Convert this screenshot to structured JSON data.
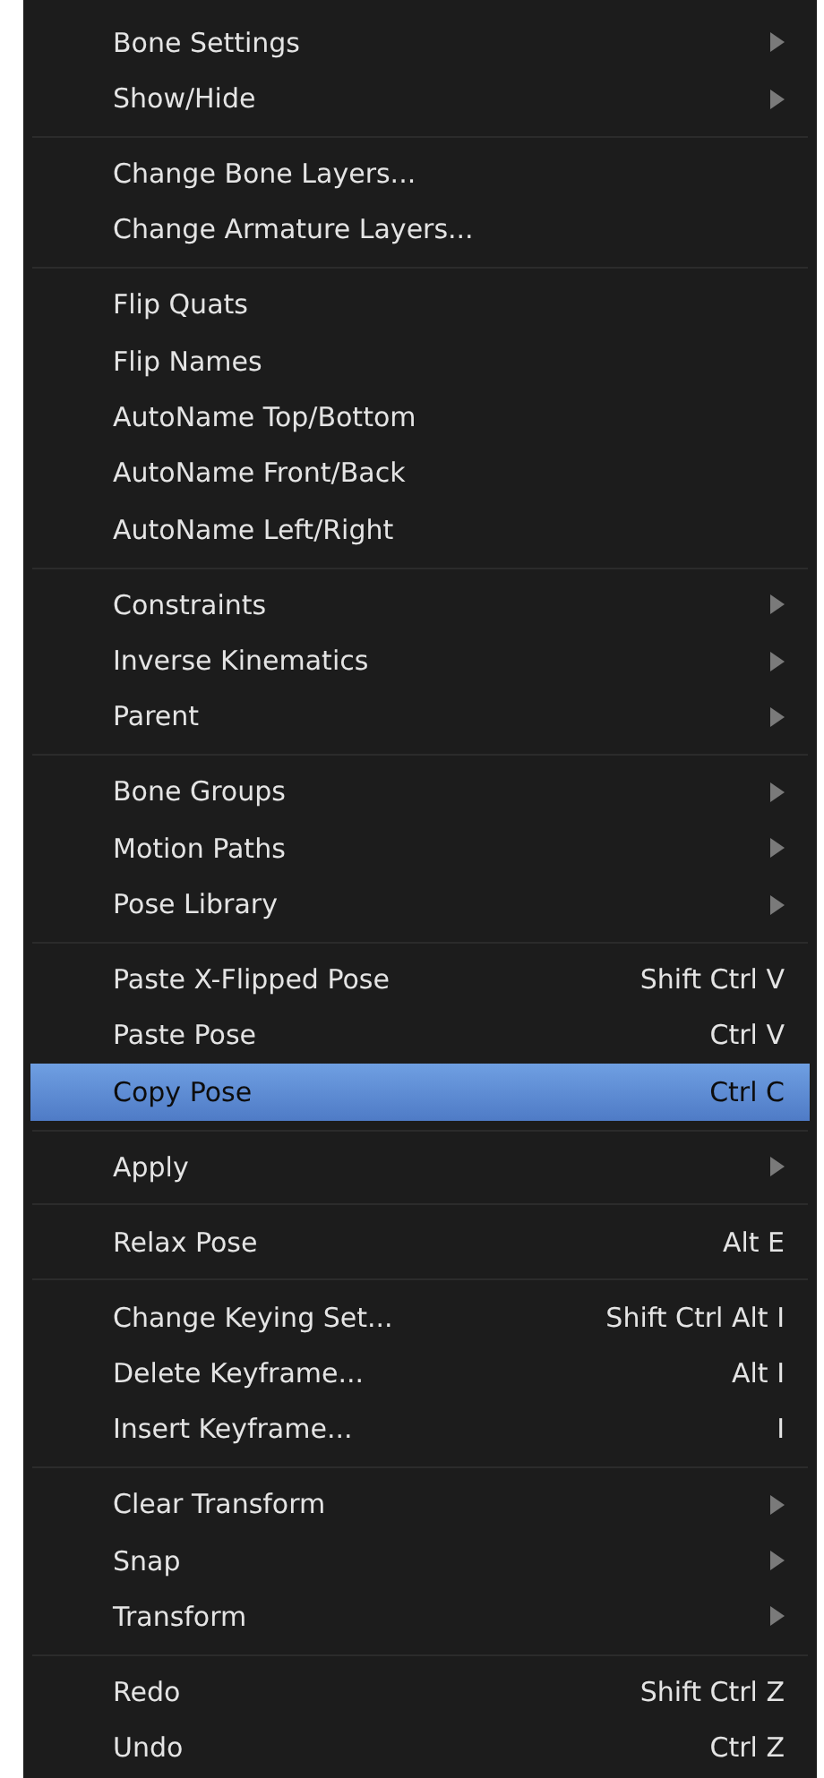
{
  "menu": {
    "groups": [
      {
        "items": [
          {
            "label": "Bone Settings",
            "submenu": true,
            "selected": false
          },
          {
            "label": "Show/Hide",
            "submenu": true,
            "selected": false
          }
        ]
      },
      {
        "items": [
          {
            "label": "Change Bone Layers...",
            "submenu": false,
            "selected": false
          },
          {
            "label": "Change Armature Layers...",
            "submenu": false,
            "selected": false
          }
        ]
      },
      {
        "items": [
          {
            "label": "Flip Quats",
            "submenu": false,
            "selected": false
          },
          {
            "label": "Flip Names",
            "submenu": false,
            "selected": false
          },
          {
            "label": "AutoName Top/Bottom",
            "submenu": false,
            "selected": false
          },
          {
            "label": "AutoName Front/Back",
            "submenu": false,
            "selected": false
          },
          {
            "label": "AutoName Left/Right",
            "submenu": false,
            "selected": false
          }
        ]
      },
      {
        "items": [
          {
            "label": "Constraints",
            "submenu": true,
            "selected": false
          },
          {
            "label": "Inverse Kinematics",
            "submenu": true,
            "selected": false
          },
          {
            "label": "Parent",
            "submenu": true,
            "selected": false
          }
        ]
      },
      {
        "items": [
          {
            "label": "Bone Groups",
            "submenu": true,
            "selected": false
          },
          {
            "label": "Motion Paths",
            "submenu": true,
            "selected": false
          },
          {
            "label": "Pose Library",
            "submenu": true,
            "selected": false
          }
        ]
      },
      {
        "items": [
          {
            "label": "Paste X-Flipped Pose",
            "shortcut": "Shift Ctrl V",
            "submenu": false,
            "selected": false
          },
          {
            "label": "Paste Pose",
            "shortcut": "Ctrl V",
            "submenu": false,
            "selected": false
          },
          {
            "label": "Copy Pose",
            "shortcut": "Ctrl C",
            "submenu": false,
            "selected": true
          }
        ]
      },
      {
        "items": [
          {
            "label": "Apply",
            "submenu": true,
            "selected": false
          }
        ]
      },
      {
        "items": [
          {
            "label": "Relax Pose",
            "shortcut": "Alt E",
            "submenu": false,
            "selected": false
          }
        ]
      },
      {
        "items": [
          {
            "label": "Change Keying Set...",
            "shortcut": "Shift Ctrl Alt I",
            "submenu": false,
            "selected": false
          },
          {
            "label": "Delete Keyframe...",
            "shortcut": "Alt I",
            "submenu": false,
            "selected": false
          },
          {
            "label": "Insert Keyframe...",
            "shortcut": "I",
            "submenu": false,
            "selected": false
          }
        ]
      },
      {
        "items": [
          {
            "label": "Clear Transform",
            "submenu": true,
            "selected": false
          },
          {
            "label": "Snap",
            "submenu": true,
            "selected": false
          },
          {
            "label": "Transform",
            "submenu": true,
            "selected": false
          }
        ]
      },
      {
        "items": [
          {
            "label": "Redo",
            "shortcut": "Shift Ctrl Z",
            "submenu": false,
            "selected": false
          },
          {
            "label": "Undo",
            "shortcut": "Ctrl Z",
            "submenu": false,
            "selected": false
          }
        ]
      }
    ]
  }
}
